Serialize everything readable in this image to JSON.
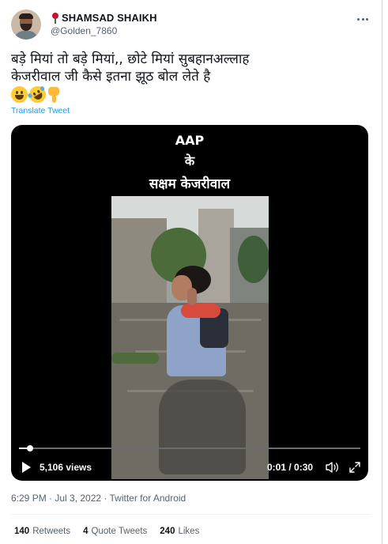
{
  "author": {
    "display_name": "SHAMSAD SHAIKH",
    "handle": "@Golden_7860",
    "name_emoji_icon": "rose-icon"
  },
  "tweet": {
    "line1": "बड़े मियां तो बड़े मियां,, छोटे मियां सुबहानअल्लाह",
    "line2": "केजरीवाल जी कैसे इतना झूठ बोल लेते है",
    "emojis": [
      "grinning-face-icon",
      "rofl-face-icon",
      "pointing-down-icon"
    ],
    "translate_label": "Translate Tweet"
  },
  "video": {
    "overlay_line1": "AAP",
    "overlay_line2": "के",
    "overlay_line3": "सक्षम केजरीवाल",
    "views_label": "5,106 views",
    "time_label": "0:01 / 0:30",
    "progress_fraction": 0.033
  },
  "meta": {
    "timestamp": "6:29 PM · Jul 3, 2022 · Twitter for Android"
  },
  "stats": {
    "retweets_count": "140",
    "retweets_label": "Retweets",
    "quotes_count": "4",
    "quotes_label": "Quote Tweets",
    "likes_count": "240",
    "likes_label": "Likes"
  },
  "colors": {
    "link": "#1d9bf0",
    "muted": "#536471",
    "text": "#0f1419"
  }
}
